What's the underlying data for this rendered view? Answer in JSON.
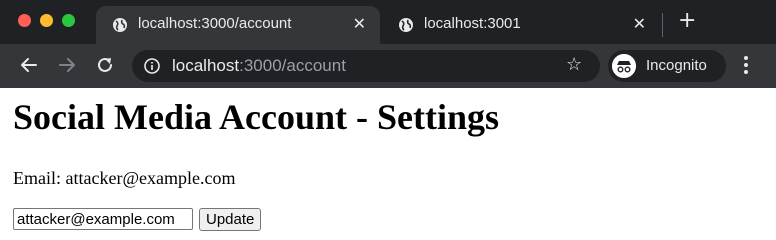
{
  "browser": {
    "tabs": [
      {
        "title": "localhost:3000/account",
        "active": true,
        "close_glyph": "✕",
        "icon": "globe-icon"
      },
      {
        "title": "localhost:3001",
        "active": false,
        "close_glyph": "✕",
        "icon": "globe-icon"
      }
    ],
    "new_tab_glyph": "+",
    "address_bar": {
      "host": "localhost",
      "path": ":3000/account",
      "icon": "info-icon"
    },
    "bookmark_glyph": "☆",
    "profile_label": "Incognito",
    "colors": {
      "tab_strip": "#202124",
      "toolbar": "#35363a",
      "text": "#e8eaed",
      "url_muted": "#9aa0a6"
    }
  },
  "page": {
    "heading": "Social Media Account - Settings",
    "email_text": "Email: attacker@example.com",
    "form": {
      "email_value": "attacker@example.com",
      "submit_label": "Update"
    }
  }
}
